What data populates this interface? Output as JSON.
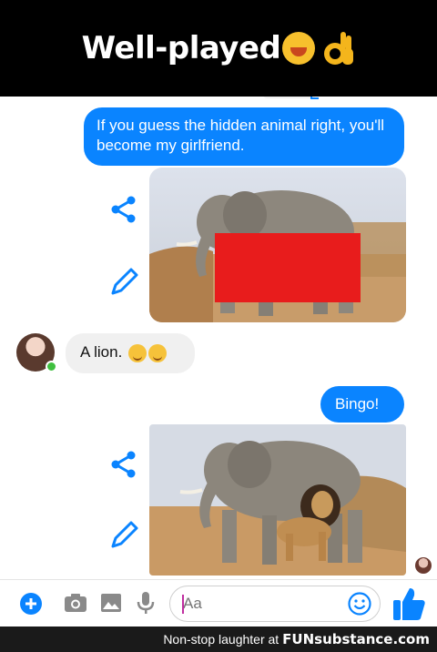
{
  "banner": {
    "title": "Well-played"
  },
  "messages": {
    "guess_prompt": "If you guess the hidden animal right, you'll become my girlfriend.",
    "reply": "A lion.",
    "bingo": "Bingo!"
  },
  "composer": {
    "placeholder": "Aa"
  },
  "footer": {
    "text": "Non-stop laughter at",
    "brand": "FUNsubstance.com"
  },
  "colors": {
    "accent": "#0a84ff",
    "censor": "#e81c1c",
    "incoming_bubble": "#f0f0f0"
  }
}
